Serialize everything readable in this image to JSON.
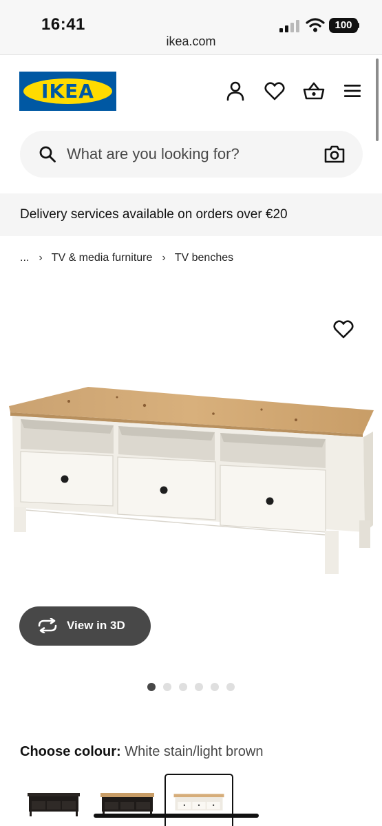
{
  "status": {
    "time": "16:41",
    "url": "ikea.com",
    "battery": "100"
  },
  "header": {
    "logo_text": "IKEA",
    "icons": [
      "profile-icon",
      "heart-icon",
      "basket-icon",
      "menu-icon"
    ]
  },
  "search": {
    "placeholder": "What are you looking for?"
  },
  "banner": {
    "text": "Delivery services available on orders over €20"
  },
  "breadcrumb": {
    "items": [
      "...",
      "TV & media furniture",
      "TV benches"
    ]
  },
  "gallery": {
    "view3d_label": "View in 3D",
    "dot_count": 6,
    "active_dot": 1
  },
  "colour": {
    "label": "Choose colour:",
    "value": "White stain/light brown",
    "swatches": [
      "black-brown",
      "black-brown/light brown",
      "white stain/light brown"
    ],
    "selected_index": 2
  },
  "colors": {
    "ikea_blue": "#0058a3",
    "ikea_yellow": "#ffdb00",
    "button_dark": "#484848",
    "light_bg": "#f5f5f5"
  }
}
